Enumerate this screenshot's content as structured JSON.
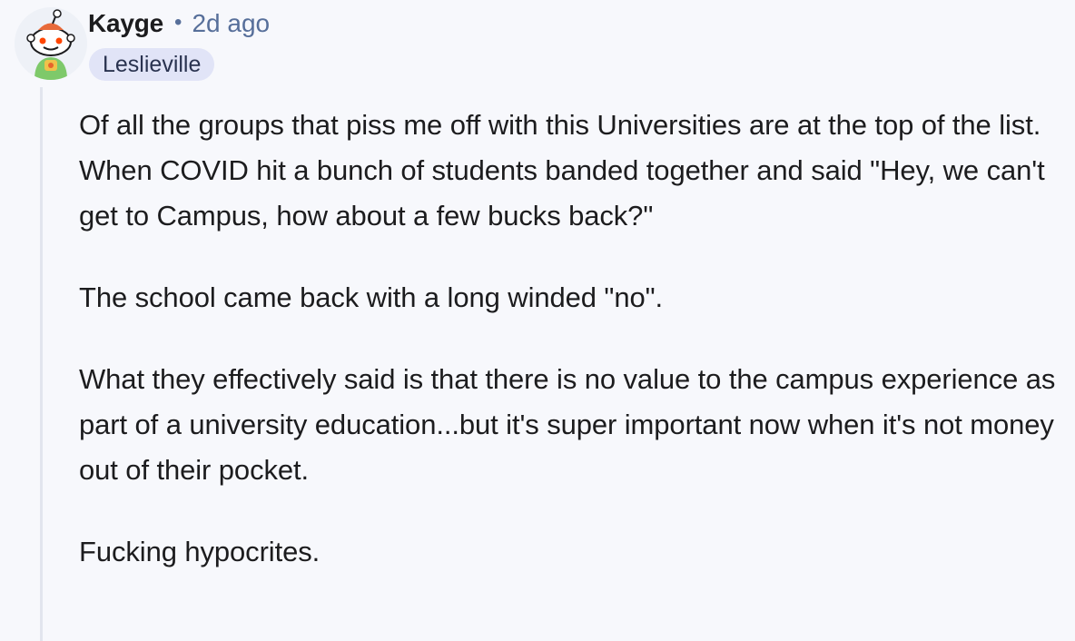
{
  "comment": {
    "author": "Kayge",
    "separator": "•",
    "timestamp": "2d ago",
    "flair": "Leslieville",
    "avatar_icon": "reddit-snoo-avatar-icon",
    "paragraphs": [
      "Of all the groups that piss me off with this Universities are at the top of the list. When COVID hit a bunch of students banded together and said \"Hey, we can't get to Campus, how about a few bucks back?\"",
      "The school came back with a long winded \"no\".",
      "What they effectively said is that there is no value to the campus experience as part of a university education...but it's super important now when it's not money out of their pocket.",
      "Fucking hypocrites."
    ]
  },
  "colors": {
    "background": "#f7f8fc",
    "meta_text": "#576f9a",
    "flair_bg": "#e1e4f7",
    "thread_line": "#e2e5ee"
  }
}
